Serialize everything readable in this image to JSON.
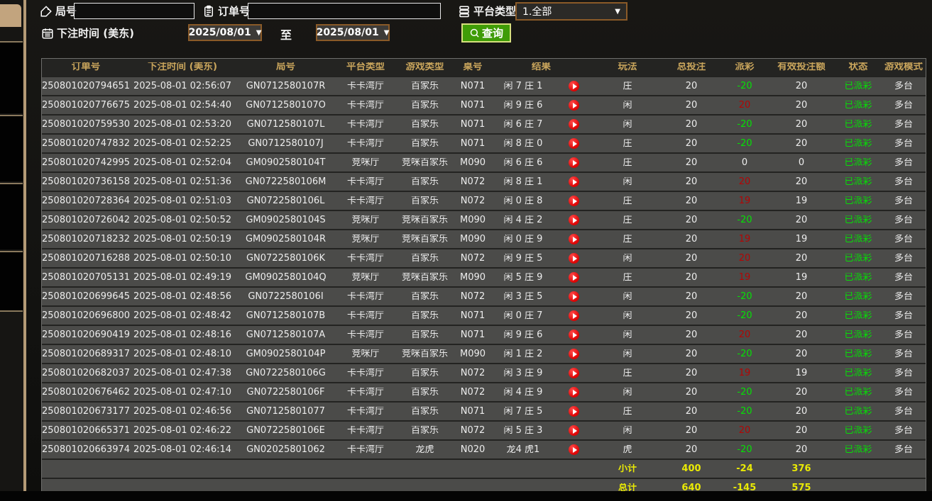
{
  "filters": {
    "game_no_label": "局号",
    "game_no_value": "",
    "order_no_label": "订单号",
    "order_no_value": "",
    "platform_label": "平台类型",
    "platform_value": "1.全部",
    "bet_time_label": "下注时间 (美东)",
    "date_from": "2025/08/01",
    "date_to": "2025/08/01",
    "to_label": "至",
    "search_label": "查询",
    "dropdown_arrow": "▼"
  },
  "colors": {
    "header_text": "#c9a55c",
    "row_bg": "#4b4b49",
    "positive_payout": "#b30505",
    "negative_payout": "#05e005",
    "status_green": "#05e005",
    "totals_yellow": "#e9e905",
    "search_green": "#3f9c07",
    "date_border_brown": "#8a5a28",
    "play_red": "#dc0303"
  },
  "table": {
    "headers": [
      "订单号",
      "下注时间 (美东)",
      "局号",
      "平台类型",
      "游戏类型",
      "桌号",
      "结果",
      "玩法",
      "总投注",
      "派彩",
      "有效投注额",
      "状态",
      "游戏模式"
    ],
    "rows": [
      {
        "order": "250801020794651",
        "time": "2025-08-01 02:56:07",
        "game_no": "GN0712580107R",
        "platform": "卡卡湾厅",
        "game_type": "百家乐",
        "table_no": "N071",
        "result": "闲 7 庄 1",
        "play": "庄",
        "bet": "20",
        "payout": "-20",
        "payout_class": "neg",
        "valid": "20",
        "status": "已派彩",
        "mode": "多台"
      },
      {
        "order": "250801020776675",
        "time": "2025-08-01 02:54:40",
        "game_no": "GN0712580107O",
        "platform": "卡卡湾厅",
        "game_type": "百家乐",
        "table_no": "N071",
        "result": "闲 9 庄 6",
        "play": "闲",
        "bet": "20",
        "payout": "20",
        "payout_class": "pos",
        "valid": "20",
        "status": "已派彩",
        "mode": "多台"
      },
      {
        "order": "250801020759530",
        "time": "2025-08-01 02:53:20",
        "game_no": "GN0712580107L",
        "platform": "卡卡湾厅",
        "game_type": "百家乐",
        "table_no": "N071",
        "result": "闲 6 庄 7",
        "play": "闲",
        "bet": "20",
        "payout": "-20",
        "payout_class": "neg",
        "valid": "20",
        "status": "已派彩",
        "mode": "多台"
      },
      {
        "order": "250801020747832",
        "time": "2025-08-01 02:52:25",
        "game_no": "GN0712580107J",
        "platform": "卡卡湾厅",
        "game_type": "百家乐",
        "table_no": "N071",
        "result": "闲 8 庄 0",
        "play": "庄",
        "bet": "20",
        "payout": "-20",
        "payout_class": "neg",
        "valid": "20",
        "status": "已派彩",
        "mode": "多台"
      },
      {
        "order": "250801020742995",
        "time": "2025-08-01 02:52:04",
        "game_no": "GM0902580104T",
        "platform": "竞咪厅",
        "game_type": "竞咪百家乐",
        "table_no": "M090",
        "result": "闲 6 庄 6",
        "play": "庄",
        "bet": "20",
        "payout": "0",
        "payout_class": "zero",
        "valid": "0",
        "status": "已派彩",
        "mode": "多台"
      },
      {
        "order": "250801020736158",
        "time": "2025-08-01 02:51:36",
        "game_no": "GN0722580106M",
        "platform": "卡卡湾厅",
        "game_type": "百家乐",
        "table_no": "N072",
        "result": "闲 8 庄 1",
        "play": "闲",
        "bet": "20",
        "payout": "20",
        "payout_class": "pos",
        "valid": "20",
        "status": "已派彩",
        "mode": "多台"
      },
      {
        "order": "250801020728364",
        "time": "2025-08-01 02:51:03",
        "game_no": "GN0722580106L",
        "platform": "卡卡湾厅",
        "game_type": "百家乐",
        "table_no": "N072",
        "result": "闲 0 庄 8",
        "play": "庄",
        "bet": "20",
        "payout": "19",
        "payout_class": "pos",
        "valid": "19",
        "status": "已派彩",
        "mode": "多台"
      },
      {
        "order": "250801020726042",
        "time": "2025-08-01 02:50:52",
        "game_no": "GM0902580104S",
        "platform": "竞咪厅",
        "game_type": "竞咪百家乐",
        "table_no": "M090",
        "result": "闲 4 庄 2",
        "play": "庄",
        "bet": "20",
        "payout": "-20",
        "payout_class": "neg",
        "valid": "20",
        "status": "已派彩",
        "mode": "多台"
      },
      {
        "order": "250801020718232",
        "time": "2025-08-01 02:50:19",
        "game_no": "GM0902580104R",
        "platform": "竞咪厅",
        "game_type": "竞咪百家乐",
        "table_no": "M090",
        "result": "闲 0 庄 9",
        "play": "庄",
        "bet": "20",
        "payout": "19",
        "payout_class": "pos",
        "valid": "19",
        "status": "已派彩",
        "mode": "多台"
      },
      {
        "order": "250801020716288",
        "time": "2025-08-01 02:50:10",
        "game_no": "GN0722580106K",
        "platform": "卡卡湾厅",
        "game_type": "百家乐",
        "table_no": "N072",
        "result": "闲 9 庄 5",
        "play": "闲",
        "bet": "20",
        "payout": "20",
        "payout_class": "pos",
        "valid": "20",
        "status": "已派彩",
        "mode": "多台"
      },
      {
        "order": "250801020705131",
        "time": "2025-08-01 02:49:19",
        "game_no": "GM0902580104Q",
        "platform": "竞咪厅",
        "game_type": "竞咪百家乐",
        "table_no": "M090",
        "result": "闲 5 庄 9",
        "play": "庄",
        "bet": "20",
        "payout": "19",
        "payout_class": "pos",
        "valid": "19",
        "status": "已派彩",
        "mode": "多台"
      },
      {
        "order": "250801020699645",
        "time": "2025-08-01 02:48:56",
        "game_no": "GN0722580106I",
        "platform": "卡卡湾厅",
        "game_type": "百家乐",
        "table_no": "N072",
        "result": "闲 3 庄 5",
        "play": "闲",
        "bet": "20",
        "payout": "-20",
        "payout_class": "neg",
        "valid": "20",
        "status": "已派彩",
        "mode": "多台"
      },
      {
        "order": "250801020696800",
        "time": "2025-08-01 02:48:42",
        "game_no": "GN0712580107B",
        "platform": "卡卡湾厅",
        "game_type": "百家乐",
        "table_no": "N071",
        "result": "闲 0 庄 7",
        "play": "闲",
        "bet": "20",
        "payout": "-20",
        "payout_class": "neg",
        "valid": "20",
        "status": "已派彩",
        "mode": "多台"
      },
      {
        "order": "250801020690419",
        "time": "2025-08-01 02:48:16",
        "game_no": "GN0712580107A",
        "platform": "卡卡湾厅",
        "game_type": "百家乐",
        "table_no": "N071",
        "result": "闲 9 庄 6",
        "play": "闲",
        "bet": "20",
        "payout": "20",
        "payout_class": "pos",
        "valid": "20",
        "status": "已派彩",
        "mode": "多台"
      },
      {
        "order": "250801020689317",
        "time": "2025-08-01 02:48:10",
        "game_no": "GM0902580104P",
        "platform": "竞咪厅",
        "game_type": "竞咪百家乐",
        "table_no": "M090",
        "result": "闲 1 庄 2",
        "play": "闲",
        "bet": "20",
        "payout": "-20",
        "payout_class": "neg",
        "valid": "20",
        "status": "已派彩",
        "mode": "多台"
      },
      {
        "order": "250801020682037",
        "time": "2025-08-01 02:47:38",
        "game_no": "GN0722580106G",
        "platform": "卡卡湾厅",
        "game_type": "百家乐",
        "table_no": "N072",
        "result": "闲 3 庄 9",
        "play": "庄",
        "bet": "20",
        "payout": "19",
        "payout_class": "pos",
        "valid": "19",
        "status": "已派彩",
        "mode": "多台"
      },
      {
        "order": "250801020676462",
        "time": "2025-08-01 02:47:10",
        "game_no": "GN0722580106F",
        "platform": "卡卡湾厅",
        "game_type": "百家乐",
        "table_no": "N072",
        "result": "闲 4 庄 9",
        "play": "闲",
        "bet": "20",
        "payout": "-20",
        "payout_class": "neg",
        "valid": "20",
        "status": "已派彩",
        "mode": "多台"
      },
      {
        "order": "250801020673177",
        "time": "2025-08-01 02:46:56",
        "game_no": "GN07125801077",
        "platform": "卡卡湾厅",
        "game_type": "百家乐",
        "table_no": "N071",
        "result": "闲 7 庄 5",
        "play": "庄",
        "bet": "20",
        "payout": "-20",
        "payout_class": "neg",
        "valid": "20",
        "status": "已派彩",
        "mode": "多台"
      },
      {
        "order": "250801020665371",
        "time": "2025-08-01 02:46:22",
        "game_no": "GN0722580106E",
        "platform": "卡卡湾厅",
        "game_type": "百家乐",
        "table_no": "N072",
        "result": "闲 5 庄 3",
        "play": "闲",
        "bet": "20",
        "payout": "20",
        "payout_class": "pos",
        "valid": "20",
        "status": "已派彩",
        "mode": "多台"
      },
      {
        "order": "250801020663974",
        "time": "2025-08-01 02:46:14",
        "game_no": "GN02025801062",
        "platform": "卡卡湾厅",
        "game_type": "龙虎",
        "table_no": "N020",
        "result": "龙4 虎1",
        "play": "虎",
        "bet": "20",
        "payout": "-20",
        "payout_class": "neg",
        "valid": "20",
        "status": "已派彩",
        "mode": "多台"
      }
    ],
    "subtotal": {
      "label": "小计",
      "bet": "400",
      "payout": "-24",
      "valid": "376"
    },
    "total": {
      "label": "总计",
      "bet": "640",
      "payout": "-145",
      "valid": "575"
    }
  }
}
